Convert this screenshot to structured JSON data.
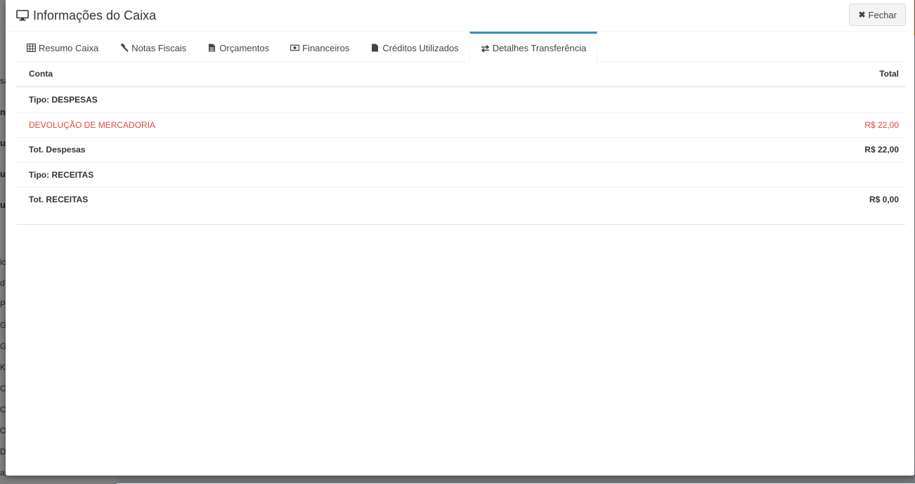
{
  "background": {
    "sidebar_fragments": [
      "sa",
      "nb",
      "u",
      "u",
      "u",
      "ic",
      "d",
      "P",
      "G",
      "G",
      "K",
      "C",
      "C",
      "O",
      "D",
      "as"
    ]
  },
  "modal": {
    "title": "Informações do Caixa",
    "title_icon": "monitor-icon",
    "close_label": "Fechar",
    "close_icon": "x-icon"
  },
  "tabs": [
    {
      "label": "Resumo Caixa",
      "icon": "table-icon"
    },
    {
      "label": "Notas Fiscais",
      "icon": "gavel-icon"
    },
    {
      "label": "Orçamentos",
      "icon": "file-text-icon"
    },
    {
      "label": "Financeiros",
      "icon": "money-icon"
    },
    {
      "label": "Créditos Utilizados",
      "icon": "file-icon"
    },
    {
      "label": "Detalhes Transferência",
      "icon": "exchange-icon",
      "active": true
    }
  ],
  "table": {
    "headers": {
      "conta": "Conta",
      "total": "Total"
    },
    "rows": [
      {
        "conta": "Tipo: DESPESAS",
        "total": "",
        "style": "bold"
      },
      {
        "conta": "DEVOLUÇÃO DE MERCADORIA",
        "total": "R$ 22,00",
        "style": "red"
      },
      {
        "conta": "Tot. Despesas",
        "total": "R$ 22,00",
        "style": "bold"
      },
      {
        "conta": "Tipo: RECEITAS",
        "total": "",
        "style": "bold"
      },
      {
        "conta": "Tot. RECEITAS",
        "total": "R$ 0,00",
        "style": "bold"
      }
    ]
  },
  "colors": {
    "accent": "#3c8dbc",
    "danger": "#dd4b39",
    "header_bg": "#f39c12"
  }
}
